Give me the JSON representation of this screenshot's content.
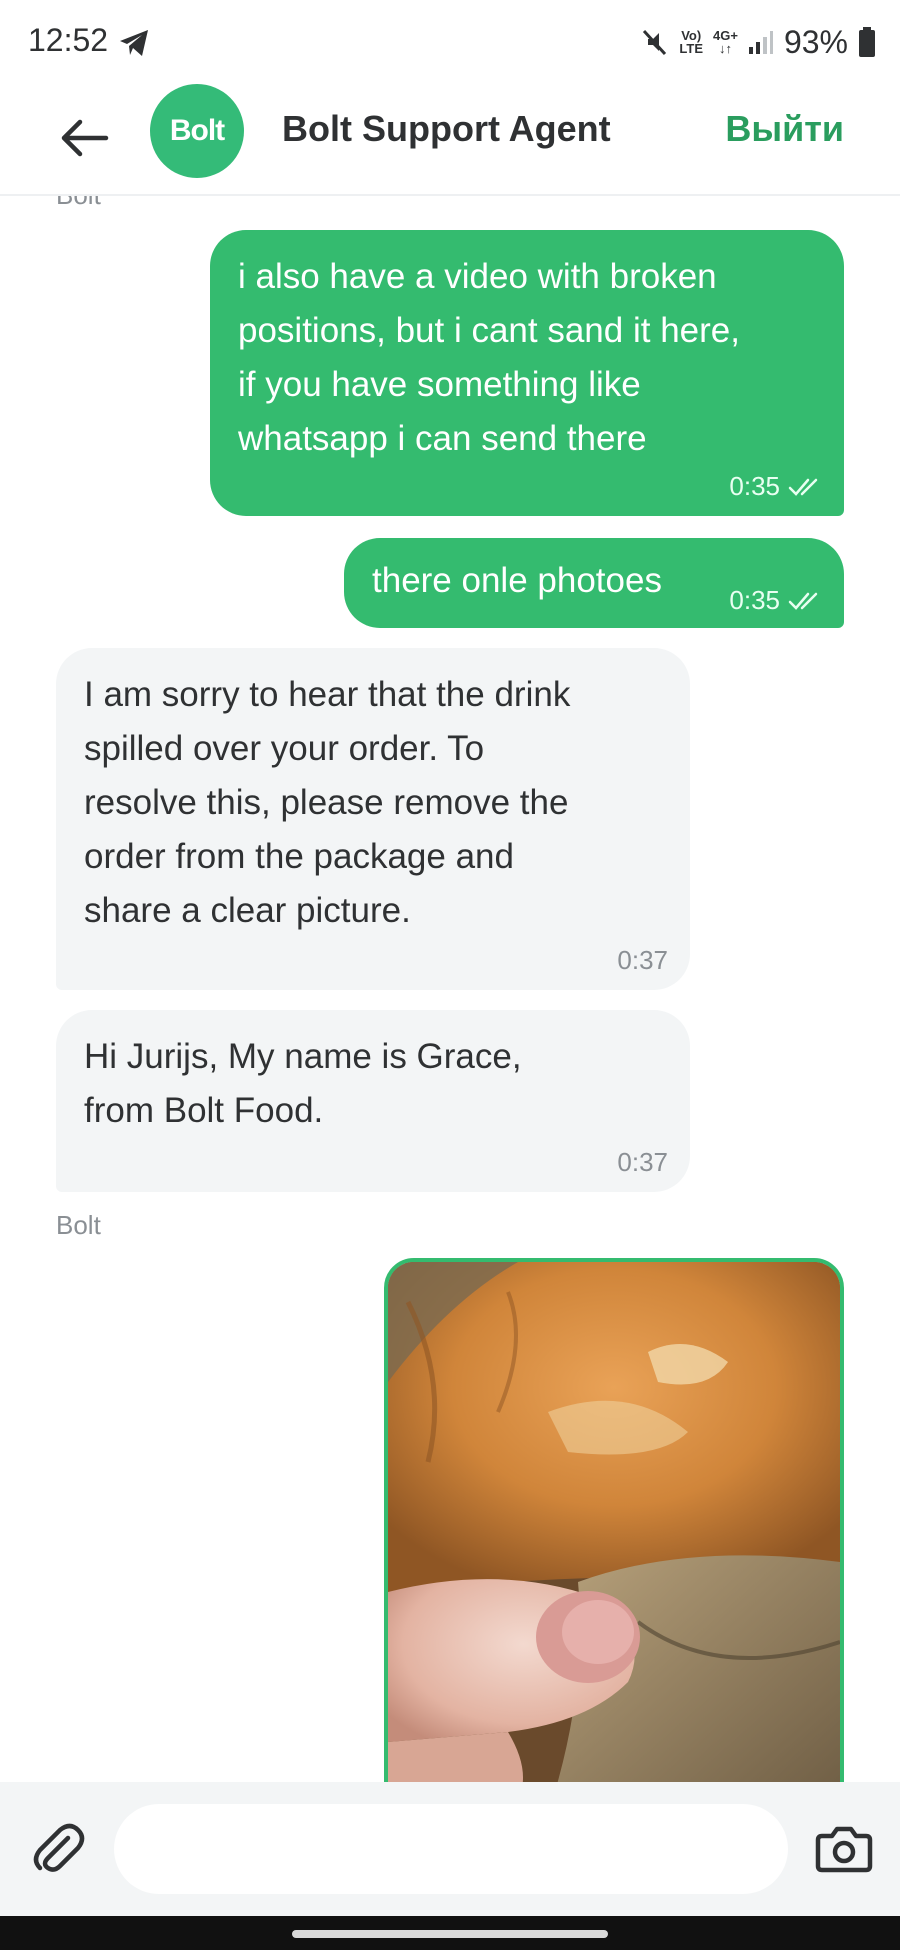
{
  "status_bar": {
    "time": "12:52",
    "volte": "Vo)",
    "lte": "LTE",
    "network": "4G+",
    "battery": "93%"
  },
  "header": {
    "avatar_text": "Bolt",
    "title": "Bolt Support Agent",
    "exit_label": "Выйти"
  },
  "messages": [
    {
      "type": "label",
      "text": "Bolt"
    },
    {
      "type": "outgoing",
      "lines": [
        "i also have a video with broken",
        "positions, but i cant sand it here,",
        "if you have something like",
        "whatsapp i can send there"
      ],
      "time": "0:35",
      "read": true
    },
    {
      "type": "outgoing",
      "lines": [
        "there onle photoes"
      ],
      "time": "0:35",
      "read": true
    },
    {
      "type": "incoming",
      "lines": [
        "I am sorry to hear that the drink",
        "spilled over your order. To",
        "resolve this, please remove the",
        "order from the package and",
        "share a clear picture."
      ],
      "time": "0:37"
    },
    {
      "type": "incoming",
      "lines": [
        "Hi Jurijs, My name is Grace,",
        "from Bolt Food."
      ],
      "time": "0:37"
    },
    {
      "type": "label",
      "text": "Bolt"
    },
    {
      "type": "photo",
      "description": "photo of food"
    }
  ],
  "input": {
    "placeholder": "",
    "value": ""
  },
  "colors": {
    "brand_green": "#34bb6f",
    "exit_green": "#2a9d5e",
    "incoming_bg": "#f3f5f6"
  },
  "icons": {
    "back": "arrow-left-icon",
    "attach": "paperclip-icon",
    "camera": "camera-icon",
    "read": "double-check-icon",
    "send": "telegram-send-icon"
  }
}
